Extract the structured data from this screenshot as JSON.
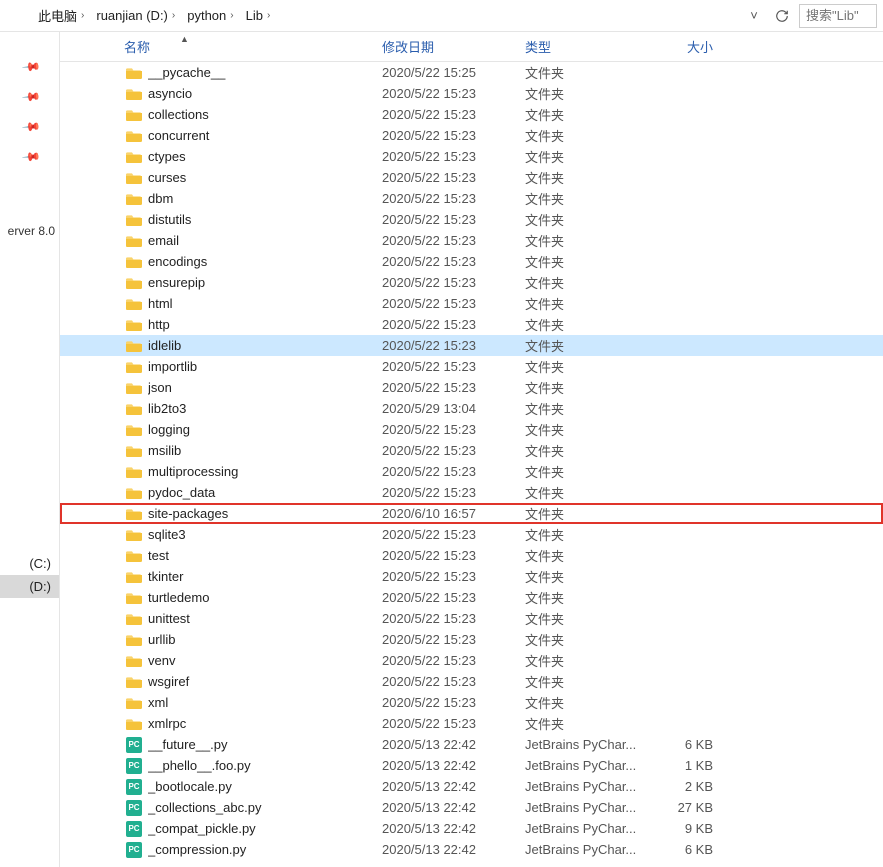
{
  "breadcrumb": [
    "此电脑",
    "ruanjian (D:)",
    "python",
    "Lib"
  ],
  "search_placeholder": "搜索\"Lib\"",
  "sidebar": {
    "label_truncated": "erver 8.0",
    "drives": [
      {
        "label": "(C:)",
        "selected": false
      },
      {
        "label": "(D:)",
        "selected": true
      }
    ]
  },
  "columns": {
    "name": "名称",
    "date": "修改日期",
    "type": "类型",
    "size": "大小"
  },
  "folder_type": "文件夹",
  "py_type": "JetBrains PyChar...",
  "file_badge": "PC",
  "rows": [
    {
      "kind": "folder",
      "name": "__pycache__",
      "date": "2020/5/22 15:25",
      "type": "文件夹",
      "size": ""
    },
    {
      "kind": "folder",
      "name": "asyncio",
      "date": "2020/5/22 15:23",
      "type": "文件夹",
      "size": ""
    },
    {
      "kind": "folder",
      "name": "collections",
      "date": "2020/5/22 15:23",
      "type": "文件夹",
      "size": ""
    },
    {
      "kind": "folder",
      "name": "concurrent",
      "date": "2020/5/22 15:23",
      "type": "文件夹",
      "size": ""
    },
    {
      "kind": "folder",
      "name": "ctypes",
      "date": "2020/5/22 15:23",
      "type": "文件夹",
      "size": ""
    },
    {
      "kind": "folder",
      "name": "curses",
      "date": "2020/5/22 15:23",
      "type": "文件夹",
      "size": ""
    },
    {
      "kind": "folder",
      "name": "dbm",
      "date": "2020/5/22 15:23",
      "type": "文件夹",
      "size": ""
    },
    {
      "kind": "folder",
      "name": "distutils",
      "date": "2020/5/22 15:23",
      "type": "文件夹",
      "size": ""
    },
    {
      "kind": "folder",
      "name": "email",
      "date": "2020/5/22 15:23",
      "type": "文件夹",
      "size": ""
    },
    {
      "kind": "folder",
      "name": "encodings",
      "date": "2020/5/22 15:23",
      "type": "文件夹",
      "size": ""
    },
    {
      "kind": "folder",
      "name": "ensurepip",
      "date": "2020/5/22 15:23",
      "type": "文件夹",
      "size": ""
    },
    {
      "kind": "folder",
      "name": "html",
      "date": "2020/5/22 15:23",
      "type": "文件夹",
      "size": ""
    },
    {
      "kind": "folder",
      "name": "http",
      "date": "2020/5/22 15:23",
      "type": "文件夹",
      "size": ""
    },
    {
      "kind": "folder",
      "name": "idlelib",
      "date": "2020/5/22 15:23",
      "type": "文件夹",
      "size": "",
      "selected": true
    },
    {
      "kind": "folder",
      "name": "importlib",
      "date": "2020/5/22 15:23",
      "type": "文件夹",
      "size": ""
    },
    {
      "kind": "folder",
      "name": "json",
      "date": "2020/5/22 15:23",
      "type": "文件夹",
      "size": ""
    },
    {
      "kind": "folder",
      "name": "lib2to3",
      "date": "2020/5/29 13:04",
      "type": "文件夹",
      "size": ""
    },
    {
      "kind": "folder",
      "name": "logging",
      "date": "2020/5/22 15:23",
      "type": "文件夹",
      "size": ""
    },
    {
      "kind": "folder",
      "name": "msilib",
      "date": "2020/5/22 15:23",
      "type": "文件夹",
      "size": ""
    },
    {
      "kind": "folder",
      "name": "multiprocessing",
      "date": "2020/5/22 15:23",
      "type": "文件夹",
      "size": ""
    },
    {
      "kind": "folder",
      "name": "pydoc_data",
      "date": "2020/5/22 15:23",
      "type": "文件夹",
      "size": ""
    },
    {
      "kind": "folder",
      "name": "site-packages",
      "date": "2020/6/10 16:57",
      "type": "文件夹",
      "size": "",
      "highlight": true
    },
    {
      "kind": "folder",
      "name": "sqlite3",
      "date": "2020/5/22 15:23",
      "type": "文件夹",
      "size": ""
    },
    {
      "kind": "folder",
      "name": "test",
      "date": "2020/5/22 15:23",
      "type": "文件夹",
      "size": ""
    },
    {
      "kind": "folder",
      "name": "tkinter",
      "date": "2020/5/22 15:23",
      "type": "文件夹",
      "size": ""
    },
    {
      "kind": "folder",
      "name": "turtledemo",
      "date": "2020/5/22 15:23",
      "type": "文件夹",
      "size": ""
    },
    {
      "kind": "folder",
      "name": "unittest",
      "date": "2020/5/22 15:23",
      "type": "文件夹",
      "size": ""
    },
    {
      "kind": "folder",
      "name": "urllib",
      "date": "2020/5/22 15:23",
      "type": "文件夹",
      "size": ""
    },
    {
      "kind": "folder",
      "name": "venv",
      "date": "2020/5/22 15:23",
      "type": "文件夹",
      "size": ""
    },
    {
      "kind": "folder",
      "name": "wsgiref",
      "date": "2020/5/22 15:23",
      "type": "文件夹",
      "size": ""
    },
    {
      "kind": "folder",
      "name": "xml",
      "date": "2020/5/22 15:23",
      "type": "文件夹",
      "size": ""
    },
    {
      "kind": "folder",
      "name": "xmlrpc",
      "date": "2020/5/22 15:23",
      "type": "文件夹",
      "size": ""
    },
    {
      "kind": "file",
      "name": "__future__.py",
      "date": "2020/5/13 22:42",
      "type": "JetBrains PyChar...",
      "size": "6 KB"
    },
    {
      "kind": "file",
      "name": "__phello__.foo.py",
      "date": "2020/5/13 22:42",
      "type": "JetBrains PyChar...",
      "size": "1 KB"
    },
    {
      "kind": "file",
      "name": "_bootlocale.py",
      "date": "2020/5/13 22:42",
      "type": "JetBrains PyChar...",
      "size": "2 KB"
    },
    {
      "kind": "file",
      "name": "_collections_abc.py",
      "date": "2020/5/13 22:42",
      "type": "JetBrains PyChar...",
      "size": "27 KB"
    },
    {
      "kind": "file",
      "name": "_compat_pickle.py",
      "date": "2020/5/13 22:42",
      "type": "JetBrains PyChar...",
      "size": "9 KB"
    },
    {
      "kind": "file",
      "name": "_compression.py",
      "date": "2020/5/13 22:42",
      "type": "JetBrains PyChar...",
      "size": "6 KB"
    }
  ]
}
